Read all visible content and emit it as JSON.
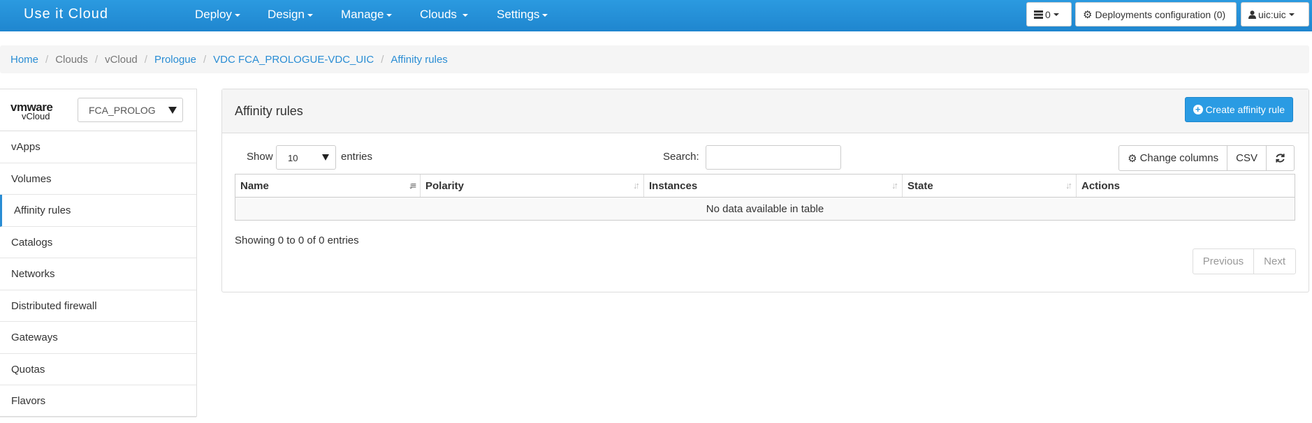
{
  "app": {
    "title": "Use it Cloud"
  },
  "nav": {
    "items": [
      {
        "label": "Deploy"
      },
      {
        "label": "Design"
      },
      {
        "label": "Manage"
      },
      {
        "label": "Clouds"
      },
      {
        "label": "Settings"
      }
    ],
    "tasks_count": "0",
    "deployments_config": "Deployments configuration (0)",
    "user": "uic:uic"
  },
  "breadcrumb": [
    {
      "label": "Home",
      "link": true
    },
    {
      "label": "Clouds",
      "link": false
    },
    {
      "label": "vCloud",
      "link": false
    },
    {
      "label": "Prologue",
      "link": true
    },
    {
      "label": "VDC FCA_PROLOGUE-VDC_UIC",
      "link": true
    },
    {
      "label": "Affinity rules",
      "link": true
    }
  ],
  "sidebar": {
    "logo_vm": "vmware",
    "logo_product": "vCloud",
    "selected_vdc": "FCA_PROLOGUE-VDC_UIC",
    "items": [
      {
        "label": "vApps"
      },
      {
        "label": "Volumes"
      },
      {
        "label": "Affinity rules",
        "active": true
      },
      {
        "label": "Catalogs"
      },
      {
        "label": "Networks"
      },
      {
        "label": "Distributed firewall"
      },
      {
        "label": "Gateways"
      },
      {
        "label": "Quotas"
      },
      {
        "label": "Flavors"
      }
    ]
  },
  "main": {
    "title": "Affinity rules",
    "create_button": "Create affinity rule",
    "show_label": "Show",
    "page_length": "10",
    "entries_label": "entries",
    "search_label": "Search:",
    "search_value": "",
    "change_columns": "Change columns",
    "csv": "CSV",
    "columns": [
      "Name",
      "Polarity",
      "Instances",
      "State",
      "Actions"
    ],
    "empty_message": "No data available in table",
    "info": "Showing 0 to 0 of 0 entries",
    "previous": "Previous",
    "next": "Next"
  },
  "colors": {
    "navbar": "#1f86cf",
    "link": "#2a8dd4",
    "primary_button": "#2a9be3"
  }
}
